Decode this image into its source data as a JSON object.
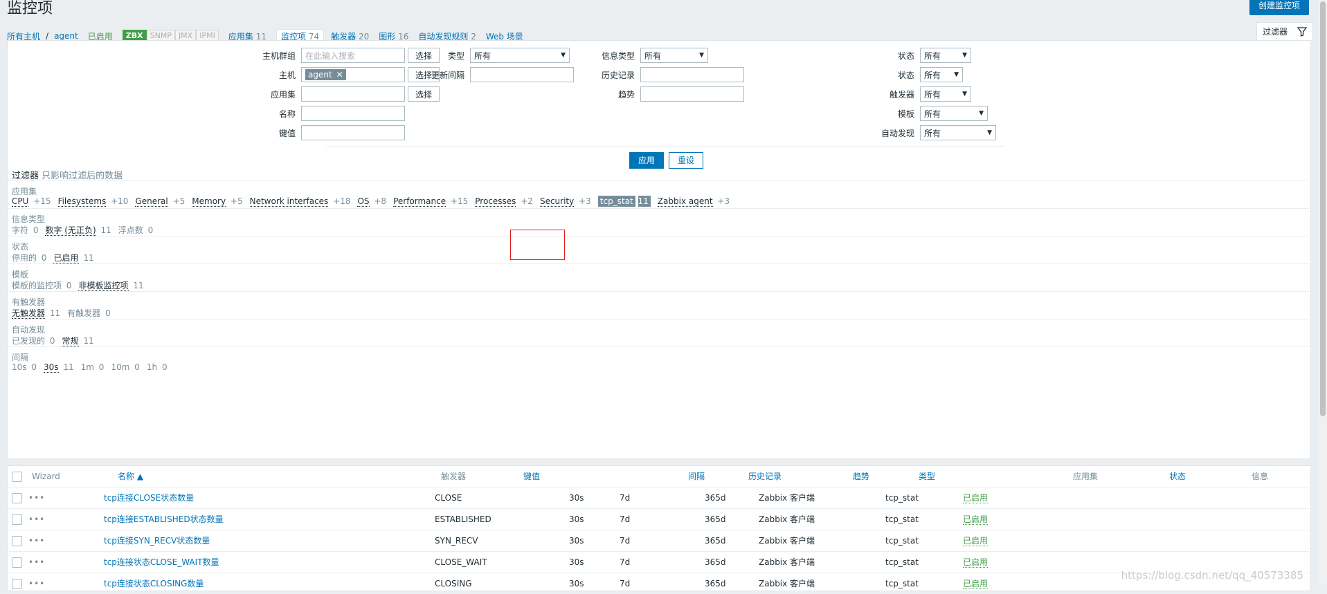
{
  "page": {
    "title": "监控项",
    "create_btn": "创建监控项"
  },
  "hostnav": {
    "all_hosts": "所有主机",
    "sep": "/",
    "host": "agent",
    "enabled": "已启用",
    "avail": [
      "ZBX",
      "SNMP",
      "JMX",
      "IPMI"
    ],
    "tabs": [
      {
        "label": "应用集",
        "count": "11"
      },
      {
        "label": "监控项",
        "count": "74"
      },
      {
        "label": "触发器",
        "count": "20"
      },
      {
        "label": "图形",
        "count": "16"
      },
      {
        "label": "自动发现规则",
        "count": "2"
      },
      {
        "label": "Web 场景",
        "count": ""
      }
    ]
  },
  "filter": {
    "tab_label": "过滤器",
    "host_group_label": "主机群组",
    "host_group_placeholder": "在此输入搜索",
    "select_btn": "选择",
    "host_label": "主机",
    "host_tag": "agent",
    "app_label": "应用集",
    "name_label": "名称",
    "key_label": "键值",
    "type_label": "类型",
    "type_val": "所有",
    "interval_label": "更新间隔",
    "info_type_label": "信息类型",
    "info_type_val": "所有",
    "history_label": "历史记录",
    "trends_label": "趋势",
    "status_label": "状态",
    "status_val": "所有",
    "state_label": "状态",
    "state_val": "所有",
    "triggers_label": "触发器",
    "triggers_val": "所有",
    "template_label": "模板",
    "template_val": "所有",
    "discovery_label": "自动发现",
    "discovery_val": "所有",
    "apply_btn": "应用",
    "reset_btn": "重设"
  },
  "subfilter": {
    "title": "过滤器",
    "note": "只影响过滤后的数据",
    "sections": [
      {
        "title": "应用集",
        "values": [
          {
            "name": "CPU",
            "count": "+15"
          },
          {
            "name": "Filesystems",
            "count": "+10"
          },
          {
            "name": "General",
            "count": "+5"
          },
          {
            "name": "Memory",
            "count": "+5"
          },
          {
            "name": "Network interfaces",
            "count": "+18"
          },
          {
            "name": "OS",
            "count": "+8"
          },
          {
            "name": "Performance",
            "count": "+15"
          },
          {
            "name": "Processes",
            "count": "+2"
          },
          {
            "name": "Security",
            "count": "+3"
          },
          {
            "name": "tcp_stat",
            "count": "11"
          },
          {
            "name": "Zabbix agent",
            "count": "+3"
          }
        ]
      },
      {
        "title": "信息类型",
        "values": [
          {
            "name": "字符",
            "count": "0"
          },
          {
            "name": "数字 (无正负)",
            "count": "11"
          },
          {
            "name": "浮点数",
            "count": "0"
          }
        ]
      },
      {
        "title": "状态",
        "values": [
          {
            "name": "停用的",
            "count": "0"
          },
          {
            "name": "已启用",
            "count": "11"
          }
        ]
      },
      {
        "title": "模板",
        "values": [
          {
            "name": "模板的监控项",
            "count": "0"
          },
          {
            "name": "非模板监控项",
            "count": "11"
          }
        ]
      },
      {
        "title": "有触发器",
        "values": [
          {
            "name": "无触发器",
            "count": "11"
          },
          {
            "name": "有触发器",
            "count": "0"
          }
        ]
      },
      {
        "title": "自动发现",
        "values": [
          {
            "name": "已发现的",
            "count": "0"
          },
          {
            "name": "常规",
            "count": "11"
          }
        ]
      },
      {
        "title": "间隔",
        "values": [
          {
            "name": "10s",
            "count": "0"
          },
          {
            "name": "30s",
            "count": "11"
          },
          {
            "name": "1m",
            "count": "0"
          },
          {
            "name": "10m",
            "count": "0"
          },
          {
            "name": "1h",
            "count": "0"
          }
        ]
      }
    ]
  },
  "table": {
    "headers": {
      "wizard": "Wizard",
      "name": "名称 ▲",
      "triggers": "触发器",
      "key": "键值",
      "interval": "间隔",
      "history": "历史记录",
      "trends": "趋势",
      "type": "类型",
      "app": "应用集",
      "status": "状态",
      "info": "信息"
    },
    "rows": [
      {
        "dots": "•••",
        "name": "tcp连接CLOSE状态数量",
        "key": "CLOSE",
        "interval": "30s",
        "history": "7d",
        "trends": "365d",
        "type": "Zabbix 客户端",
        "app": "tcp_stat",
        "status": "已启用"
      },
      {
        "dots": "•••",
        "name": "tcp连接ESTABLISHED状态数量",
        "key": "ESTABLISHED",
        "interval": "30s",
        "history": "7d",
        "trends": "365d",
        "type": "Zabbix 客户端",
        "app": "tcp_stat",
        "status": "已启用"
      },
      {
        "dots": "•••",
        "name": "tcp连接SYN_RECV状态数量",
        "key": "SYN_RECV",
        "interval": "30s",
        "history": "7d",
        "trends": "365d",
        "type": "Zabbix 客户端",
        "app": "tcp_stat",
        "status": "已启用"
      },
      {
        "dots": "•••",
        "name": "tcp连接状态CLOSE_WAIT数量",
        "key": "CLOSE_WAIT",
        "interval": "30s",
        "history": "7d",
        "trends": "365d",
        "type": "Zabbix 客户端",
        "app": "tcp_stat",
        "status": "已启用"
      },
      {
        "dots": "•••",
        "name": "tcp连接状态CLOSING数量",
        "key": "CLOSING",
        "interval": "30s",
        "history": "7d",
        "trends": "365d",
        "type": "Zabbix 客户端",
        "app": "tcp_stat",
        "status": "已启用"
      }
    ]
  },
  "watermark": "https://blog.csdn.net/qq_40573385"
}
